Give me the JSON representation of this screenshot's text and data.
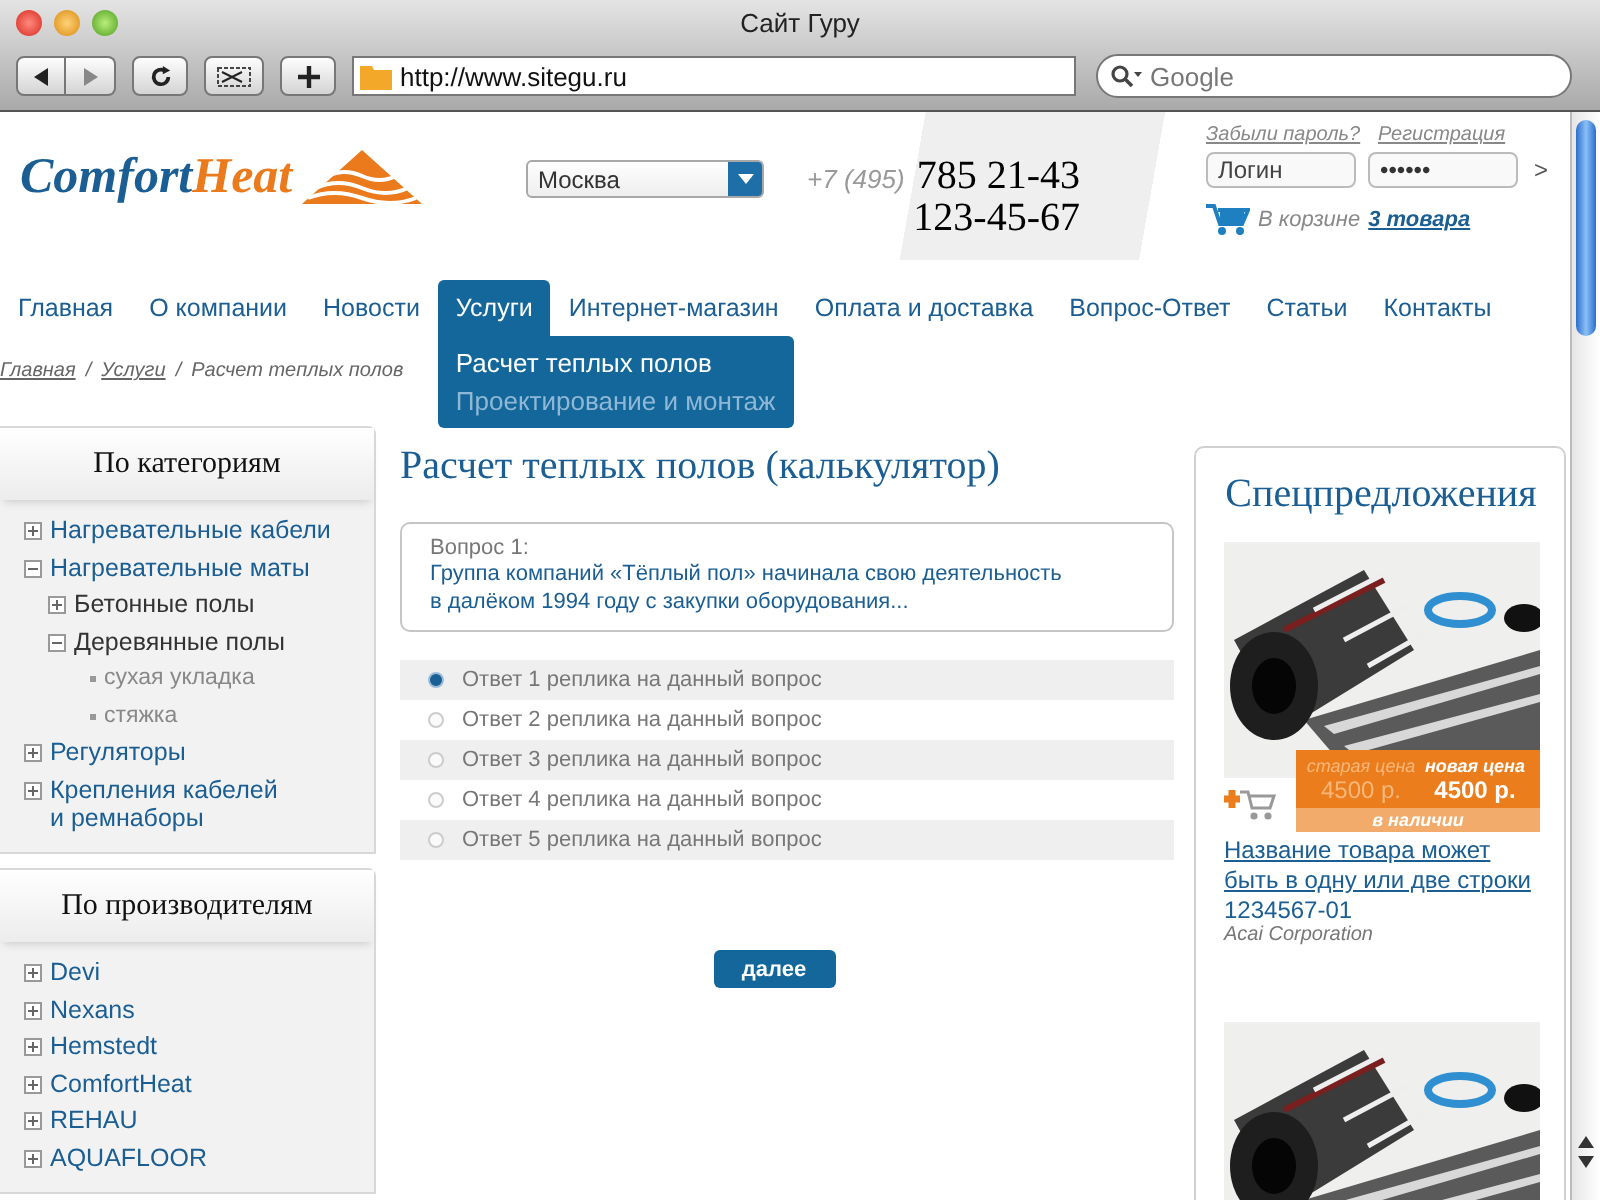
{
  "window": {
    "title": "Сайт Гуру"
  },
  "address_bar": {
    "url": "http://www.sitegu.ru"
  },
  "search": {
    "placeholder": "Google"
  },
  "logo": {
    "first": "Comfort",
    "second": "Heat"
  },
  "city_select": {
    "value": "Москва"
  },
  "phone": {
    "code": "+7 (495)",
    "numbers": [
      "785 21-43",
      "123-45-67"
    ]
  },
  "login": {
    "forgot": "Забыли пароль?",
    "register": "Регистрация",
    "login_placeholder": "Логин",
    "password": "••••••",
    "submit": ">"
  },
  "cart": {
    "label": "В корзине",
    "link": "3 товара"
  },
  "nav": [
    {
      "label": "Главная",
      "selected": false
    },
    {
      "label": "О компании",
      "selected": false
    },
    {
      "label": "Новости",
      "selected": false
    },
    {
      "label": "Услуги",
      "selected": true,
      "submenu": [
        {
          "label": "Расчет теплых полов",
          "selected": true
        },
        {
          "label": "Проектирование и монтаж",
          "selected": false
        }
      ]
    },
    {
      "label": "Интернет-магазин",
      "selected": false
    },
    {
      "label": "Оплата и доставка",
      "selected": false
    },
    {
      "label": "Вопрос-Ответ",
      "selected": false
    },
    {
      "label": "Статьи",
      "selected": false
    },
    {
      "label": "Контакты",
      "selected": false
    }
  ],
  "breadcrumbs": [
    {
      "label": "Главная",
      "kind": "link"
    },
    {
      "label": "/",
      "kind": "separator"
    },
    {
      "label": "Услуги",
      "kind": "link"
    },
    {
      "label": "/",
      "kind": "separator"
    },
    {
      "label": "Расчет теплых полов",
      "kind": "current"
    }
  ],
  "categories": {
    "title": "По категориям",
    "items": [
      {
        "label": "Нагревательные кабели",
        "expanded": false
      },
      {
        "label": "Нагревательные маты",
        "expanded": true,
        "children": [
          {
            "label": "Бетонные полы",
            "expanded": false
          },
          {
            "label": "Деревянные полы",
            "expanded": true,
            "children": [
              {
                "label": "сухая укладка"
              },
              {
                "label": "стяжка"
              }
            ]
          }
        ]
      },
      {
        "label": "Регуляторы",
        "expanded": false
      },
      {
        "label": "Крепления кабелей\nи ремнаборы",
        "expanded": false
      }
    ]
  },
  "manufacturers": {
    "title": "По производителям",
    "items": [
      {
        "label": "Devi",
        "expanded": false
      },
      {
        "label": "Nexans",
        "expanded": false
      },
      {
        "label": "Hemstedt",
        "expanded": false
      },
      {
        "label": "ComfortHeat",
        "expanded": false
      },
      {
        "label": "REHAU",
        "expanded": false
      },
      {
        "label": "AQUAFLOOR",
        "expanded": false
      }
    ]
  },
  "main": {
    "title": "Расчет теплых полов (калькулятор)",
    "question_label": "Вопрос 1:",
    "question_text": "Группа компаний «Тёплый пол» начинала свою деятельность\nв далёком 1994 году с закупки оборудования...",
    "answers": [
      {
        "label": "Ответ 1 реплика на данный вопрос",
        "selected": true
      },
      {
        "label": "Ответ 2 реплика на данный вопрос",
        "selected": false
      },
      {
        "label": "Ответ 3 реплика на данный вопрос",
        "selected": false
      },
      {
        "label": "Ответ 4 реплика на данный вопрос",
        "selected": false
      },
      {
        "label": "Ответ 5 реплика на данный вопрос",
        "selected": false
      }
    ],
    "next_button": "далее"
  },
  "specials": {
    "title": "Спецпредложения",
    "products": [
      {
        "kind": "full",
        "old_price_label": "старая цена",
        "old_price": "4500 р.",
        "new_price_label": "новая цена",
        "new_price": "4500 р.",
        "availability": "в наличии",
        "name": "Название товара может\nбыть в одну или две строки",
        "code": "1234567-01",
        "vendor": "Acai Corporation"
      },
      {
        "kind": "partial"
      }
    ]
  }
}
